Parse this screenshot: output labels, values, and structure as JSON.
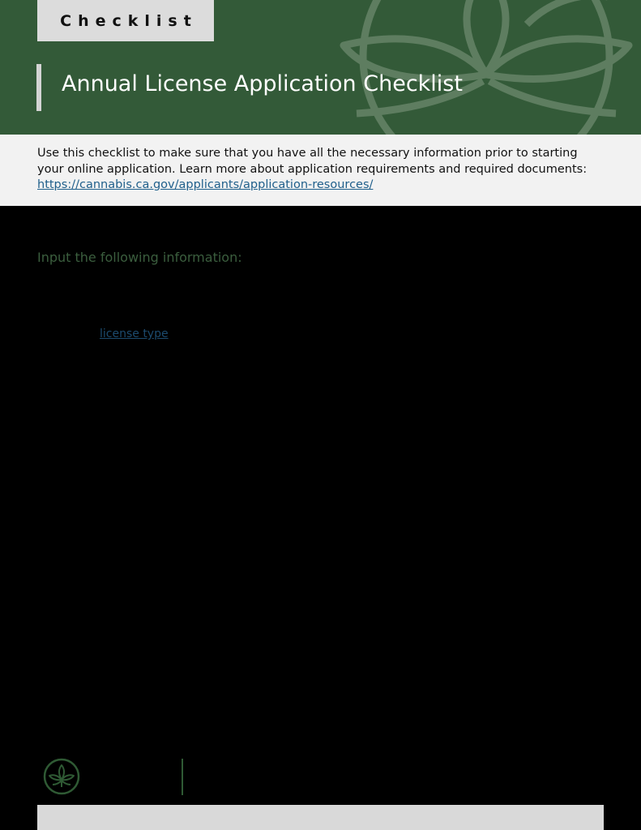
{
  "header": {
    "badge_text": "Checklist",
    "title": "Annual License Application Checklist",
    "background_color": "#335a38",
    "decoration_icon": "cannabis-leaf-watermark"
  },
  "intro": {
    "text": "Use this checklist to make sure that you have all the necessary information prior to starting your online application. Learn more about application requirements and required documents: ",
    "link_text": "https://cannabis.ca.gov/applicants/application-resources/"
  },
  "body": {
    "section_label": "Input the following information:",
    "inline_link_text": "license type"
  },
  "footer": {
    "logo_icon": "cannabis-leaf-logo",
    "accent_color": "#2f5a34"
  }
}
